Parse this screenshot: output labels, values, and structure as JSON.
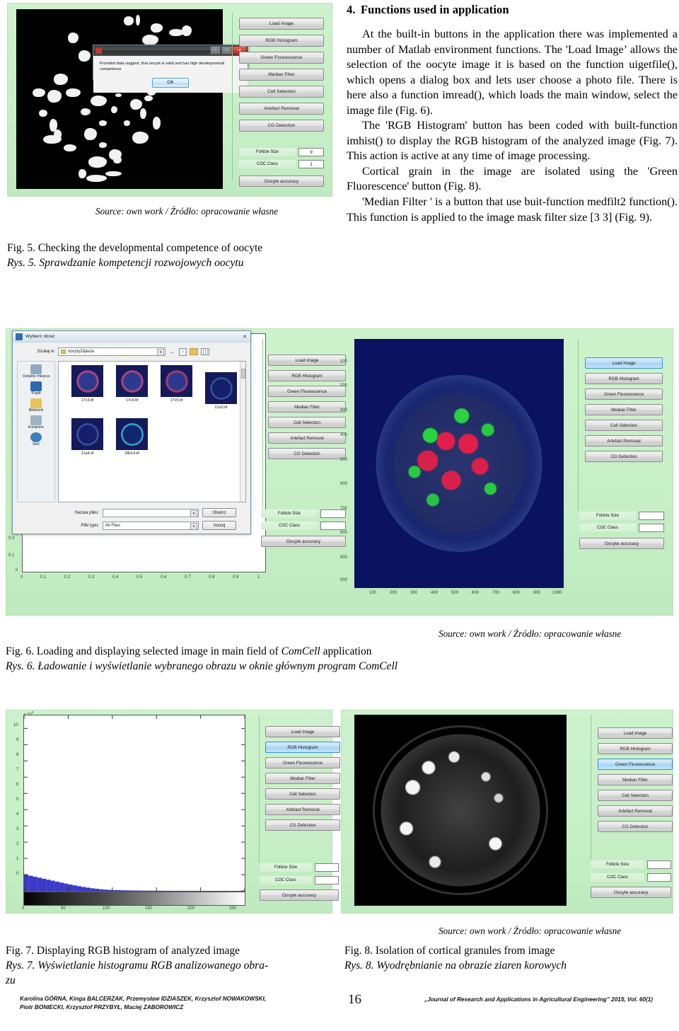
{
  "section": {
    "number": "4.",
    "title": "Functions used in application",
    "paragraphs": [
      "At the built-in buttons in the application there was implemented a number of Matlab environment functions. The 'Load Image’ allows the selection of the oocyte image it is based on the function uigetfile(), which opens a dialog box and lets user choose a photo file. There is here also a function imread(), which loads the main window, select the image file (Fig. 6).",
      "The 'RGB Histogram' button has been coded with built-function imhist() to display the RGB histogram of the analyzed image (Fig. 7). This action is active at any time of image processing.",
      "Cortical grain in the image are isolated using the 'Green Fluorescence' button (Fig. 8).",
      "'Median Filter ' is a button that use buit-function medfilt2 function(). This function is applied to the image mask filter size [3 3] (Fig. 9)."
    ]
  },
  "app": {
    "buttons": [
      "Load Image",
      "RGB Histogram",
      "Green Fluorescence",
      "Median Filter",
      "Cell Selection",
      "Artefact Removal",
      "CG Detection"
    ],
    "follicle_label": "Follicle Size",
    "coc_label": "COC Class",
    "accuracy_label": "Oocyte accuracy",
    "panel_bg": "#c8f0c8",
    "selected_bg": "#b9def6"
  },
  "fig5": {
    "follicle_value": "9",
    "coc_value": "1",
    "selected_button": "",
    "dialog": {
      "title": "",
      "message": "Provided data suggest, that oocyte is valid and has high developmental competence",
      "ok_label": "OK",
      "minimize_glyph": "–",
      "maximize_glyph": "□",
      "close_glyph": "✕"
    },
    "source": "Source: own work / Źródło: opracowanie własne",
    "caption_en": "Fig. 5. Checking the developmental competence of oocyte",
    "caption_pl": "Rys. 5. Sprawdzanie kompetencji rozwojowych oocytu"
  },
  "fig6": {
    "selected_button": "Load Image",
    "follicle_value": "",
    "coc_value": "",
    "dialog": {
      "title": "Wybierz obraz",
      "close_glyph": "✕",
      "lookin_label": "Szukaj w:",
      "lookin_value": "oocytyZdjecia",
      "dropdown_glyph": "▾",
      "toolbar_icons": [
        "back-arrow-icon",
        "up-folder-icon",
        "new-folder-icon",
        "views-icon"
      ],
      "places": [
        {
          "label": "Ostatnie miejsca",
          "icon": "recent-places-icon",
          "color": "#8fa9bf"
        },
        {
          "label": "Pulpit",
          "icon": "desktop-icon",
          "color": "#2c6ab0"
        },
        {
          "label": "Biblioteki",
          "icon": "libraries-icon",
          "color": "#e8c35a"
        },
        {
          "label": "Komputer",
          "icon": "computer-icon",
          "color": "#9fb3c6"
        },
        {
          "label": "Sieć",
          "icon": "network-icon",
          "color": "#3c7dc4"
        }
      ],
      "files": [
        {
          "name": "17c3.tif",
          "ring": "#c24a7a",
          "core": "#2b3a8f"
        },
        {
          "name": "17c4.tif",
          "ring": "#c24a7a",
          "core": "#2b3a8f"
        },
        {
          "name": "17c5.tif",
          "ring": "#b8406e",
          "core": "#2b3a8f"
        },
        {
          "name": "21a3.tif",
          "ring": "#3a5fb0",
          "core": "#16206a"
        },
        {
          "name": "21a4.tif",
          "ring": "#3a5fb0",
          "core": "#16206a"
        },
        {
          "name": "28b14.tif",
          "ring": "#35c9d6",
          "core": "#10266e"
        }
      ],
      "filename_label": "Nazwa pliku:",
      "filename_value": "",
      "filetype_label": "Pliki typu:",
      "filetype_value": "All Files",
      "open_label": "Otwórz",
      "cancel_label": "Anuluj"
    },
    "small_axes": {
      "y_ticks": [
        "0.2",
        "0.1",
        "0"
      ],
      "x_ticks": [
        "0",
        "0.1",
        "0.2",
        "0.3",
        "0.4",
        "0.5",
        "0.6",
        "0.7",
        "0.8",
        "0.9",
        "1"
      ]
    },
    "main_axes": {
      "y_ticks": [
        "100",
        "200",
        "300",
        "400",
        "500",
        "600",
        "700",
        "800",
        "900",
        "000"
      ],
      "x_ticks": [
        "100",
        "200",
        "300",
        "400",
        "500",
        "600",
        "700",
        "800",
        "900",
        "1000"
      ]
    },
    "source": "Source: own work / Źródło: opracowanie własne",
    "caption_en_a": "Fig. 6. Loading and displaying selected image in main field of ",
    "caption_en_b": "ComCell",
    "caption_en_c": " application",
    "caption_pl": "Rys. 6. Ładowanie i wyświetlanie wybranego obrazu w oknie głównym program ComCell"
  },
  "fig7": {
    "selected_button": "RGB Histogram",
    "follicle_value": "",
    "coc_value": "",
    "caption_en": "Fig. 7. Displaying RGB histogram of analyzed image",
    "caption_pl": "Rys. 7. Wyświetlanie histogramu RGB analizowanego obra-",
    "caption_pl2": "zu"
  },
  "fig8": {
    "selected_button": "Green Fluorescence",
    "follicle_value": "",
    "coc_value": "",
    "source": "Source: own work / Źródło: opracowanie własne",
    "caption_en": "Fig. 8. Isolation of cortical granules from image",
    "caption_pl": "Rys. 8. Wyodrębnianie na obrazie ziaren korowych"
  },
  "chart_data": {
    "type": "bar",
    "title": "",
    "xlabel": "",
    "ylabel": "",
    "exponent_label": "x 10",
    "exponent_sup": "4",
    "x": [
      0,
      5,
      10,
      15,
      20,
      25,
      30,
      35,
      40,
      45,
      50,
      55,
      60,
      65,
      70,
      75,
      80,
      85,
      90,
      95,
      100,
      110,
      120,
      130,
      140,
      150,
      160,
      170,
      180,
      190,
      200,
      210,
      220,
      230,
      240,
      250
    ],
    "values": [
      1.0,
      0.93,
      0.87,
      0.81,
      0.75,
      0.69,
      0.63,
      0.57,
      0.51,
      0.45,
      0.39,
      0.34,
      0.29,
      0.24,
      0.2,
      0.16,
      0.13,
      0.1,
      0.08,
      0.06,
      0.05,
      0.035,
      0.025,
      0.018,
      0.013,
      0.01,
      0.008,
      0.006,
      0.005,
      0.004,
      0.003,
      0.002,
      0.002,
      0.001,
      0.001,
      0.001
    ],
    "xlim": [
      0,
      250
    ],
    "ylim": [
      0,
      10.8
    ],
    "x_ticks": [
      "0",
      "50",
      "100",
      "150",
      "200",
      "250"
    ],
    "y_ticks": [
      "0",
      "1",
      "2",
      "3",
      "4",
      "5",
      "6",
      "7",
      "8",
      "9",
      "10"
    ],
    "bar_color": "#3a39c8",
    "grid": false,
    "legend": "none",
    "colorbar": {
      "from": "#000000",
      "to": "#ffffff",
      "position": "below-axis"
    }
  },
  "footer": {
    "authors_line1": "Karolina GÓRNA, Kinga BALCERZAK, Przemysław IDZIASZEK, Krzysztof NOWAKOWSKI,",
    "authors_line2": "Piotr BONIECKI, Krzysztof PRZYBYŁ, Maciej ZABOROWICZ",
    "page_number": "16",
    "journal": "„Journal of Research and Applications in Agricultural Engineering” 2015, Vol. 60(1)"
  }
}
